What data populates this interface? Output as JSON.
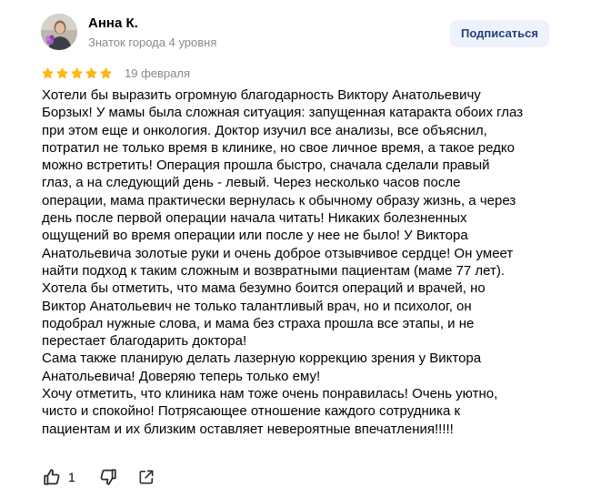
{
  "author": {
    "name": "Анна К.",
    "level": "Знаток города 4 уровня",
    "avatar": "user-photo"
  },
  "subscribe_label": "Подписаться",
  "rating": {
    "value": 5,
    "max": 5,
    "star_color": "#fdb813",
    "date": "19 февраля"
  },
  "review_lines": [
    "Хотели бы выразить огромную благодарность Виктору Анатольевичу",
    "Борзых! У мамы была сложная ситуация: запущенная катаракта обоих глаз",
    "при этом еще и онкология. Доктор изучил все анализы, все объяснил,",
    "потратил не только время в клинике, но свое личное время, а такое редко",
    "можно встретить! Операция прошла быстро, сначала сделали правый",
    "глаз, а на следующий день - левый. Через несколько часов после",
    "операции, мама практически вернулась к обычному образу жизнь, а через",
    "день после первой операции начала читать! Никаких болезненных",
    "ощущений во время операции или после у нее не было! У Виктора",
    "Анатольевича золотые руки и очень доброе отзывчивое сердце! Он умеет",
    "найти подход к таким сложным и возвратными пациентам (маме 77 лет).",
    "Хотела бы отметить, что мама безумно боится операций и врачей, но",
    "Виктор Анатольевич не только талантливый врач, но и психолог, он",
    "подобрал нужные слова, и мама без страха прошла все этапы, и не",
    "перестает благодарить доктора!",
    "Сама также планирую делать лазерную коррекцию зрения у Виктора",
    "Анатольевича! Доверяю теперь только ему!",
    "Хочу отметить, что клиника нам тоже очень понравилась! Очень уютно,",
    "чисто и спокойно! Потрясающее отношение каждого сотрудника к",
    "пациентам и их близким оставляет невероятные впечатления!!!!!"
  ],
  "actions": {
    "like_icon": "thumbs-up-icon",
    "like_count": "1",
    "dislike_icon": "thumbs-down-icon",
    "share_icon": "share-icon"
  }
}
